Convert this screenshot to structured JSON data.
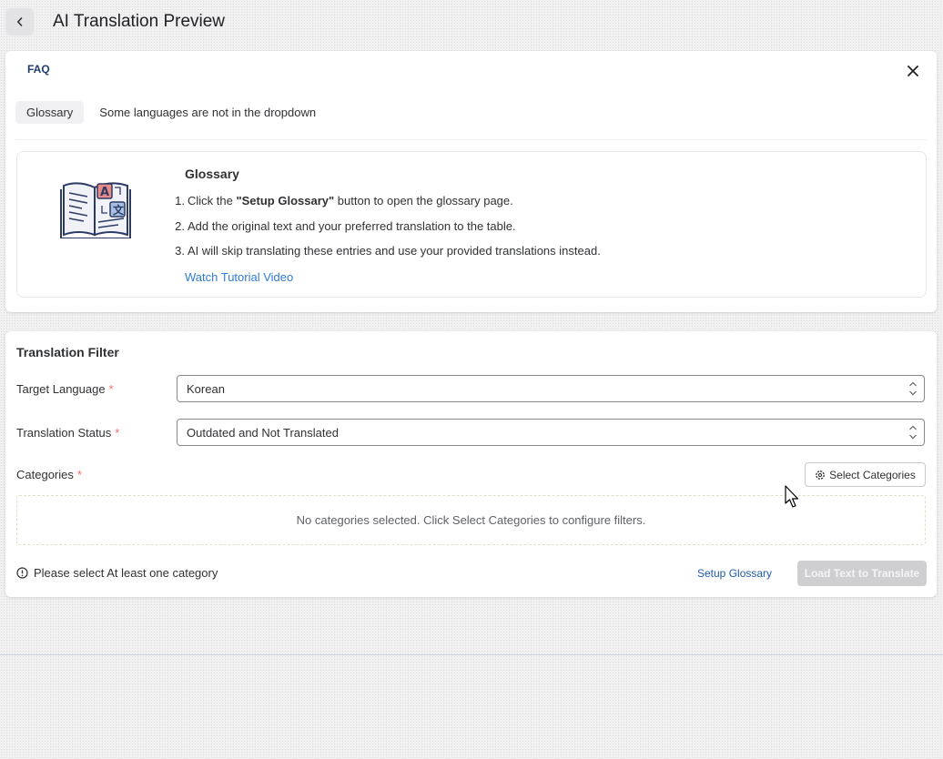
{
  "header": {
    "title": "AI Translation Preview"
  },
  "faq": {
    "title": "FAQ",
    "tabs": [
      {
        "label": "Glossary",
        "active": true
      },
      {
        "label": "Some languages are not in the dropdown",
        "active": false
      }
    ],
    "glossary": {
      "heading": "Glossary",
      "step1_prefix": "Click the ",
      "step1_bold": "\"Setup Glossary\"",
      "step1_suffix": " button to open the glossary page.",
      "step2": "Add the original text and your preferred translation to the table.",
      "step3": "AI will skip translating these entries and use your provided translations instead.",
      "tutorial_link": "Watch Tutorial Video"
    }
  },
  "filter": {
    "title": "Translation Filter",
    "target_language": {
      "label": "Target Language",
      "value": "Korean"
    },
    "translation_status": {
      "label": "Translation Status",
      "value": "Outdated and Not Translated"
    },
    "categories": {
      "label": "Categories",
      "button_label": "Select Categories",
      "empty_text": "No categories selected. Click Select Categories to configure filters."
    },
    "warning": "Please select At least one category",
    "setup_glossary": "Setup Glossary",
    "load_button": "Load Text to Translate"
  },
  "colors": {
    "accent": "#2f7bd8",
    "required": "#f56c6c",
    "disabled_button": "#cfcfd1"
  }
}
